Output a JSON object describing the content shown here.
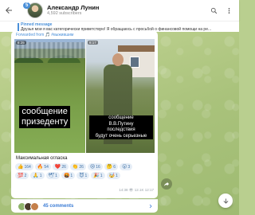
{
  "header": {
    "unread_count": "5",
    "channel_name": "Александр Лунин",
    "subscribers": "4,592 subscribers"
  },
  "pinned": {
    "label": "Pinned message",
    "text": "Друзья мои я вас категорически приветствую! Я обращаюсь с просьбой о финансовой помощи на ре..."
  },
  "message": {
    "forwarded_from": "Forwarded from 🎵 #выжившим",
    "photo_left": {
      "time": "8:25",
      "caption": "сообщение\nпризеденту"
    },
    "photo_right": {
      "time": "8:17",
      "caption": "сообщение\nВ.В.Путину\nпоследствия\nбудут очень серьезные"
    },
    "text": "Максимальная оглаcка",
    "reactions": [
      {
        "emoji": "👍",
        "count": "164"
      },
      {
        "emoji": "🔥",
        "count": "54"
      },
      {
        "emoji": "❤️",
        "count": "26"
      },
      {
        "emoji": "👏",
        "count": "26"
      },
      {
        "emoji": "😢",
        "count": "16"
      },
      {
        "emoji": "🤔",
        "count": "6"
      },
      {
        "emoji": "😮",
        "count": "3"
      },
      {
        "emoji": "💯",
        "count": "2"
      },
      {
        "emoji": "🙏",
        "count": "1"
      },
      {
        "emoji": "🕊",
        "count": "1"
      },
      {
        "emoji": "🤬",
        "count": "1"
      },
      {
        "emoji": "😈",
        "count": "1"
      },
      {
        "emoji": "🎉",
        "count": "1"
      },
      {
        "emoji": "🤯",
        "count": "1"
      }
    ],
    "meta": "14:38 👁 12.1K 12:17"
  },
  "comments": {
    "label": "45 comments"
  },
  "colors": {
    "accent": "#4a90d9",
    "link": "#3a7bd5",
    "bubble": "#ffffff",
    "reaction_bg": "#e6eef7"
  },
  "icons": {
    "back": "arrow-left-icon",
    "search": "search-icon",
    "menu": "more-vertical-icon",
    "share": "share-icon",
    "scroll_down": "arrow-down-icon",
    "chevron": "chevron-right-icon"
  }
}
